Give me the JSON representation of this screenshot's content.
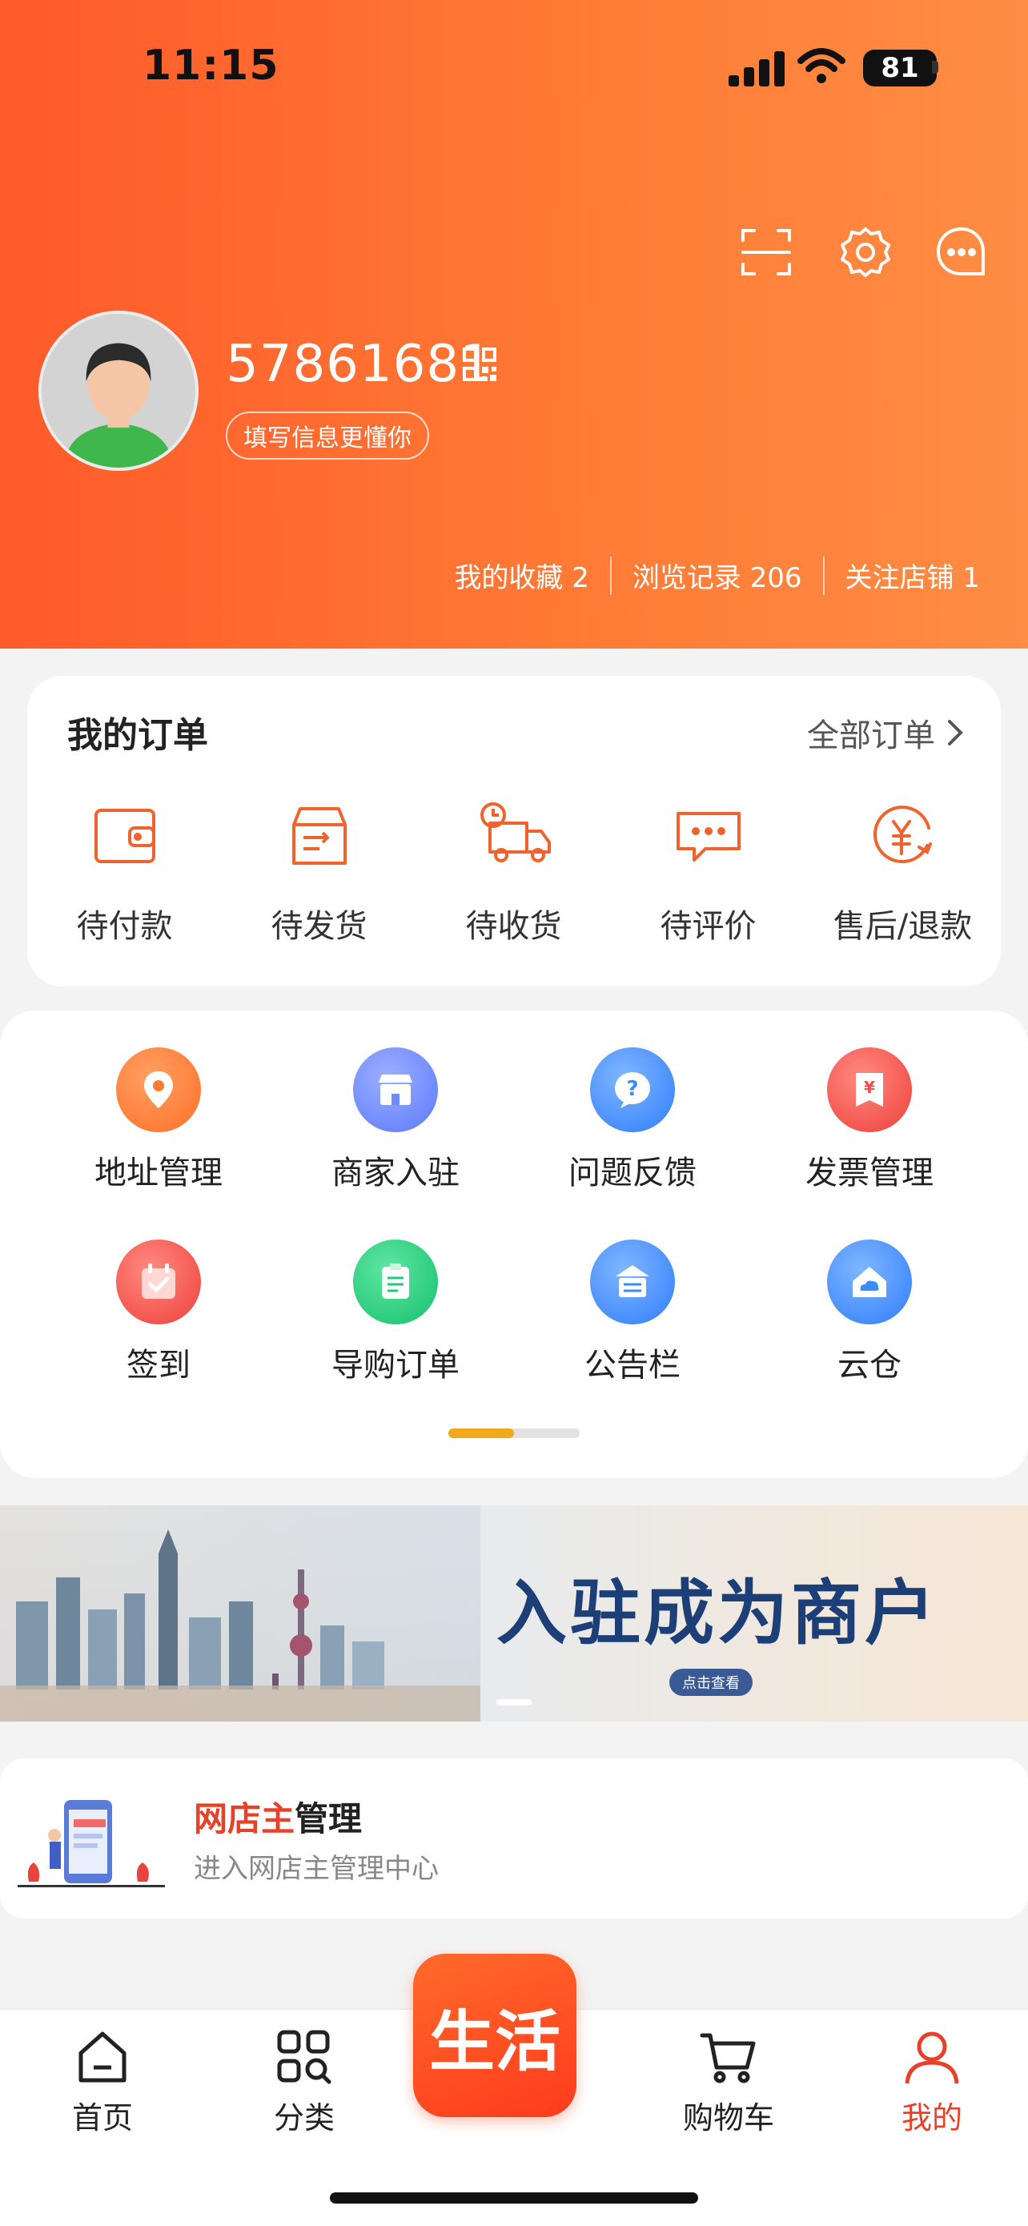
{
  "status_bar": {
    "time": "11:15",
    "battery": "81"
  },
  "profile": {
    "user_id": "57861681",
    "tag": "填写信息更懂你",
    "stats": [
      {
        "label": "我的收藏 2"
      },
      {
        "label": "浏览记录 206"
      },
      {
        "label": "关注店铺 1"
      }
    ]
  },
  "orders": {
    "title": "我的订单",
    "all_label": "全部订单",
    "items": [
      {
        "label": "待付款",
        "icon": "wallet-icon"
      },
      {
        "label": "待发货",
        "icon": "box-icon"
      },
      {
        "label": "待收货",
        "icon": "truck-icon"
      },
      {
        "label": "待评价",
        "icon": "comment-icon"
      },
      {
        "label": "售后/退款",
        "icon": "refund-icon"
      }
    ]
  },
  "services": [
    {
      "label": "地址管理",
      "icon": "location-icon",
      "color": "#ff7a32"
    },
    {
      "label": "商家入驻",
      "icon": "store-icon",
      "color": "#6f8cff"
    },
    {
      "label": "问题反馈",
      "icon": "question-icon",
      "color": "#3b8cff"
    },
    {
      "label": "发票管理",
      "icon": "invoice-icon",
      "color": "#f0504a"
    },
    {
      "label": "签到",
      "icon": "calendar-icon",
      "color": "#f0504a"
    },
    {
      "label": "导购订单",
      "icon": "clipboard-icon",
      "color": "#22c97a"
    },
    {
      "label": "公告栏",
      "icon": "notice-icon",
      "color": "#3b8cff"
    },
    {
      "label": "云仓",
      "icon": "cloud-icon",
      "color": "#3b8cff"
    }
  ],
  "banner": {
    "title": "入驻成为商户",
    "button": "点击查看"
  },
  "shop_owner": {
    "title_highlight": "网店主",
    "title_rest": "管理",
    "subtitle": "进入网店主管理中心"
  },
  "tabs": [
    {
      "label": "首页",
      "icon": "home-icon"
    },
    {
      "label": "分类",
      "icon": "category-icon"
    },
    {
      "label": "生活",
      "icon": "life-icon"
    },
    {
      "label": "购物车",
      "icon": "cart-icon"
    },
    {
      "label": "我的",
      "icon": "profile-icon"
    }
  ],
  "colors": {
    "accent": "#ff5a2a",
    "active_tab": "#e8412a",
    "icon_orange": "#f0622e"
  }
}
